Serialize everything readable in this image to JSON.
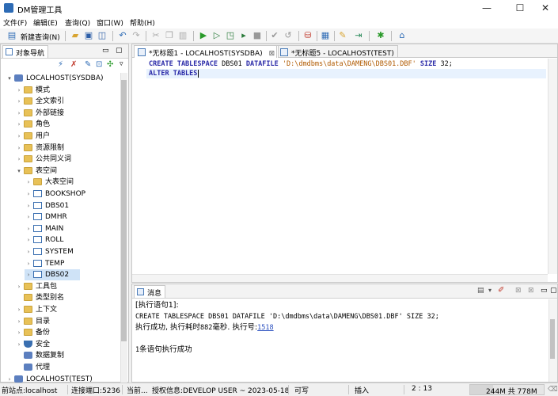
{
  "window": {
    "title": "DM管理工具",
    "minimize": "—",
    "maximize": "☐",
    "close": "✕"
  },
  "menu": [
    "文件(F)",
    "编辑(E)",
    "查询(Q)",
    "窗口(W)",
    "帮助(H)"
  ],
  "toolbar": {
    "new_query_label": "新建查询(N)"
  },
  "nav": {
    "tab_label": "对象导航",
    "tree": [
      {
        "label": "LOCALHOST(SYSDBA)",
        "depth": 0,
        "twisty": "▾",
        "icon": "db"
      },
      {
        "label": "模式",
        "depth": 1,
        "twisty": "›",
        "icon": "folder"
      },
      {
        "label": "全文索引",
        "depth": 1,
        "twisty": "›",
        "icon": "folder"
      },
      {
        "label": "外部链接",
        "depth": 1,
        "twisty": "›",
        "icon": "folder"
      },
      {
        "label": "角色",
        "depth": 1,
        "twisty": "›",
        "icon": "folder"
      },
      {
        "label": "用户",
        "depth": 1,
        "twisty": "›",
        "icon": "folder"
      },
      {
        "label": "资源限制",
        "depth": 1,
        "twisty": "›",
        "icon": "folder"
      },
      {
        "label": "公共同义词",
        "depth": 1,
        "twisty": "›",
        "icon": "folder"
      },
      {
        "label": "表空间",
        "depth": 1,
        "twisty": "▾",
        "icon": "folder"
      },
      {
        "label": "大表空间",
        "depth": 2,
        "twisty": "›",
        "icon": "folder"
      },
      {
        "label": "BOOKSHOP",
        "depth": 2,
        "twisty": "›",
        "icon": "tbl"
      },
      {
        "label": "DBS01",
        "depth": 2,
        "twisty": "›",
        "icon": "tbl"
      },
      {
        "label": "DMHR",
        "depth": 2,
        "twisty": "›",
        "icon": "tbl"
      },
      {
        "label": "MAIN",
        "depth": 2,
        "twisty": "›",
        "icon": "tbl"
      },
      {
        "label": "ROLL",
        "depth": 2,
        "twisty": "›",
        "icon": "tbl"
      },
      {
        "label": "SYSTEM",
        "depth": 2,
        "twisty": "›",
        "icon": "tbl"
      },
      {
        "label": "TEMP",
        "depth": 2,
        "twisty": "›",
        "icon": "tbl"
      },
      {
        "label": "DBS02",
        "depth": 2,
        "twisty": "›",
        "icon": "tbl",
        "selected": true
      },
      {
        "label": "工具包",
        "depth": 1,
        "twisty": "›",
        "icon": "folder"
      },
      {
        "label": "类型别名",
        "depth": 1,
        "twisty": "",
        "icon": "folder"
      },
      {
        "label": "上下文",
        "depth": 1,
        "twisty": "›",
        "icon": "folder"
      },
      {
        "label": "目录",
        "depth": 1,
        "twisty": "›",
        "icon": "folder"
      },
      {
        "label": "备份",
        "depth": 1,
        "twisty": "›",
        "icon": "folder"
      },
      {
        "label": "安全",
        "depth": 1,
        "twisty": "›",
        "icon": "shield"
      },
      {
        "label": "数据复制",
        "depth": 1,
        "twisty": "",
        "icon": "db"
      },
      {
        "label": "代理",
        "depth": 1,
        "twisty": "",
        "icon": "db"
      },
      {
        "label": "LOCALHOST(TEST)",
        "depth": 0,
        "twisty": "›",
        "icon": "db"
      }
    ]
  },
  "editor": {
    "tabs": [
      {
        "label": "*无标题1 - LOCALHOST(SYSDBA)",
        "close": "⊠",
        "active": true
      },
      {
        "label": "*无标题5 - LOCALHOST(TEST)",
        "close": "",
        "active": false
      }
    ],
    "line1": {
      "kw1": "CREATE TABLESPACE",
      "mid": " DBS01 ",
      "kw2": "DATAFILE",
      "str": " 'D:\\dmdbms\\data\\DAMENG\\DBS01.DBF'",
      "kw3": " SIZE",
      "tail": " 32;"
    },
    "line2": {
      "kw1": "ALTER TABLES",
      "tail": ""
    }
  },
  "messages": {
    "tab_label": "消息",
    "lines": {
      "l1": "[执行语句1]:",
      "l2": "CREATE TABLESPACE DBS01 DATAFILE 'D:\\dmdbms\\data\\DAMENG\\DBS01.DBF' SIZE 32;",
      "l3_prefix": "执行成功, 执行耗时",
      "l3_ms": "882",
      "l3_mid": "毫秒. 执行号:",
      "l3_id": "1518",
      "l4_num": "1",
      "l4_text": "条语句执行成功"
    }
  },
  "status": {
    "site": "前站点:localhost",
    "port": "连接端口:5236",
    "current": "当前...",
    "license": "授权信息:DEVELOP USER ~ 2023-05-18",
    "writable": "可写",
    "insert": "插入",
    "cursor": "2 : 13",
    "memory": "244M 共 778M",
    "memory_used_fraction": 0.31
  }
}
